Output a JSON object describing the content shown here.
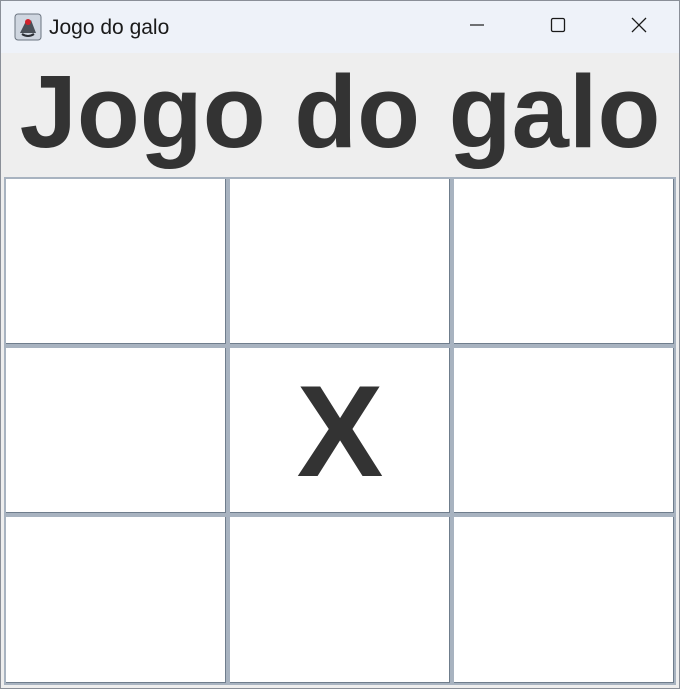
{
  "window": {
    "title": "Jogo do galo",
    "app_icon": "java-duke-icon",
    "controls": {
      "minimize_icon": "minimize-icon",
      "maximize_icon": "maximize-icon",
      "close_icon": "close-icon"
    }
  },
  "header": {
    "title": "Jogo do galo"
  },
  "board": {
    "cells": [
      [
        "",
        "",
        ""
      ],
      [
        "",
        "X",
        ""
      ],
      [
        "",
        "",
        ""
      ]
    ]
  },
  "colors": {
    "titlebar": "#eef2f9",
    "panel": "#eeeeee",
    "text": "#333333",
    "cell_background": "#ffffff",
    "cell_border": "#a8b3c0"
  }
}
